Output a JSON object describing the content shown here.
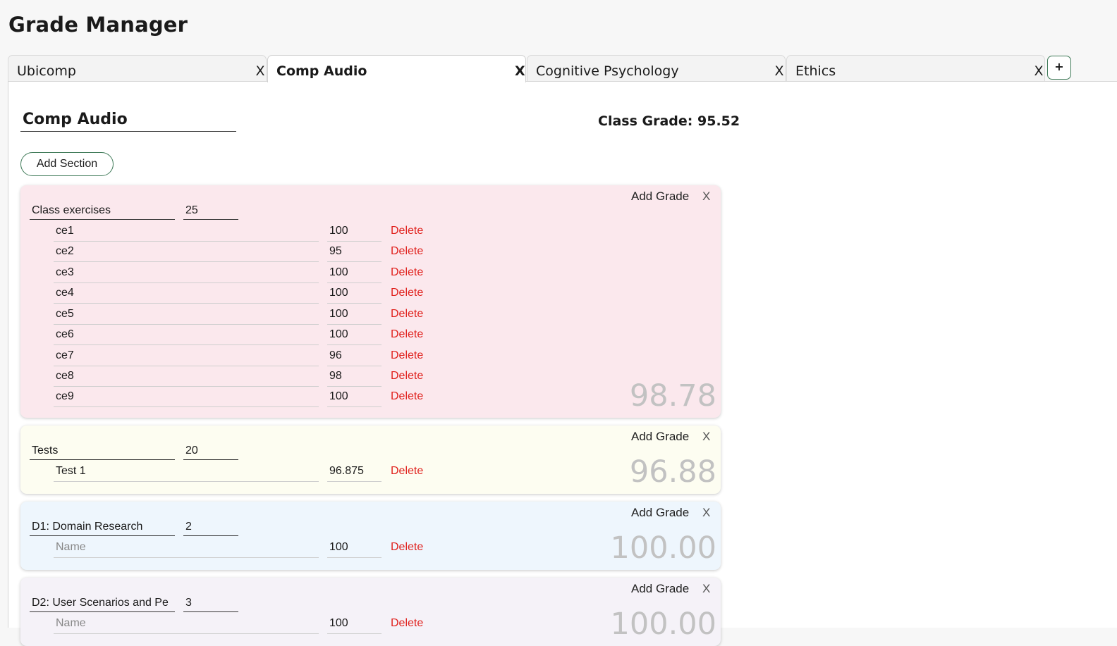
{
  "app": {
    "title": "Grade Manager"
  },
  "tabs": [
    {
      "label": "Ubicomp",
      "close": "X"
    },
    {
      "label": "Comp Audio",
      "close": "X"
    },
    {
      "label": "Cognitive Psychology",
      "close": "X"
    },
    {
      "label": "Ethics",
      "close": "X"
    }
  ],
  "add_tab_label": "+",
  "active_tab": "Comp Audio",
  "main": {
    "class_name": "Comp Audio",
    "class_grade": "Class Grade: 95.52",
    "add_section_label": "Add Section"
  },
  "section_controls": {
    "add_grade_label": "Add Grade",
    "close_label": "X",
    "delete_label": "Delete",
    "name_placeholder": "Name"
  },
  "colors": {
    "accent": "#3f7a58",
    "delete": "#e0201c",
    "section_pink": "#fbe8ed",
    "section_yellow": "#fdfdf1",
    "section_blue": "#eef6fd",
    "section_lavender": "#f5f2f8"
  },
  "sections": [
    {
      "name": "Class exercises",
      "weight": "25",
      "average": "98.78",
      "grades": [
        {
          "name": "ce1",
          "score": "100"
        },
        {
          "name": "ce2",
          "score": "95"
        },
        {
          "name": "ce3",
          "score": "100"
        },
        {
          "name": "ce4",
          "score": "100"
        },
        {
          "name": "ce5",
          "score": "100"
        },
        {
          "name": "ce6",
          "score": "100"
        },
        {
          "name": "ce7",
          "score": "96"
        },
        {
          "name": "ce8",
          "score": "98"
        },
        {
          "name": "ce9",
          "score": "100"
        }
      ]
    },
    {
      "name": "Tests",
      "weight": "20",
      "average": "96.88",
      "grades": [
        {
          "name": "Test 1",
          "score": "96.875"
        }
      ]
    },
    {
      "name": "D1: Domain Research",
      "weight": "2",
      "average": "100.00",
      "grades": [
        {
          "name": "",
          "score": "100"
        }
      ]
    },
    {
      "name": "D2: User Scenarios and Pe",
      "weight": "3",
      "average": "100.00",
      "grades": [
        {
          "name": "",
          "score": "100"
        }
      ]
    }
  ]
}
